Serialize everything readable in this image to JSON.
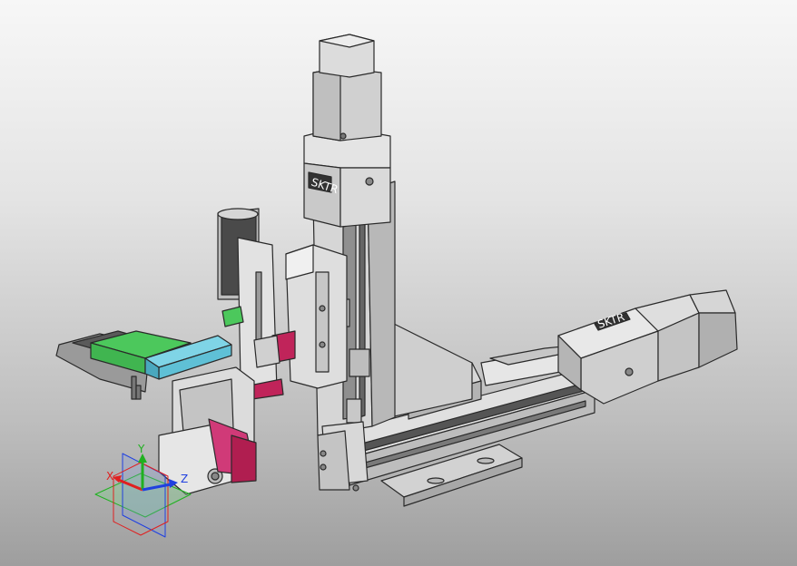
{
  "viewport": {
    "background_top": "#f7f7f7",
    "background_bottom": "#9e9e9e"
  },
  "model": {
    "vertical_motor_brand": "SKTR",
    "horizontal_motor_brand": "SKTR",
    "colors": {
      "body": "#dcdcdc",
      "outline": "#2a2a2a",
      "green_part": "#4cc85c",
      "cyan_part": "#5fc0d6",
      "magenta_part": "#c0245a",
      "dark_rail": "#4a4a4a"
    }
  },
  "triad": {
    "x_label": "X",
    "y_label": "Y",
    "z_label": "Z",
    "x_color": "#e02020",
    "y_color": "#20b020",
    "z_color": "#2040e0"
  }
}
